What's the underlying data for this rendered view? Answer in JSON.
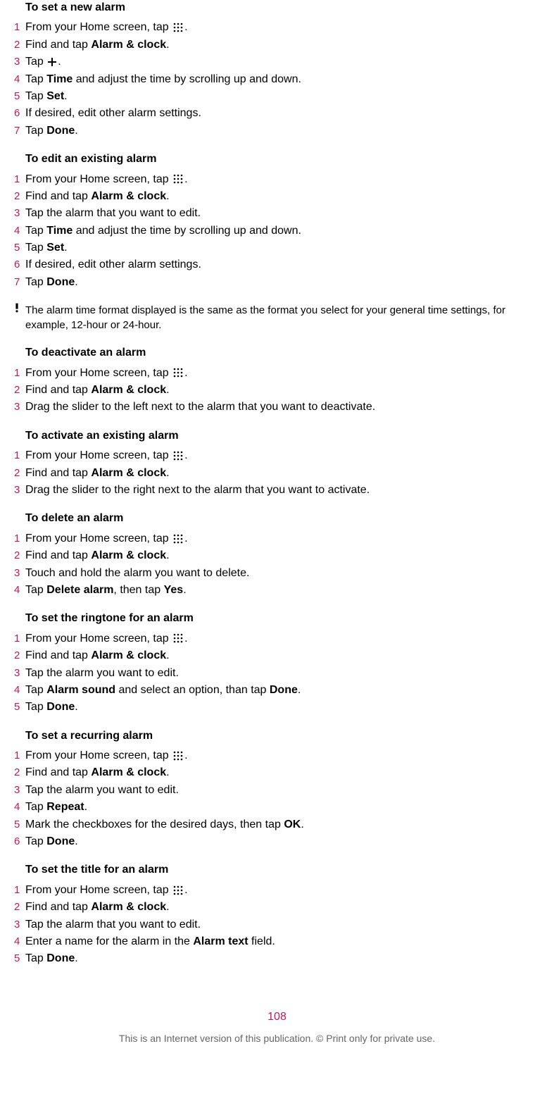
{
  "sections": [
    {
      "title": "To set a new alarm",
      "steps": [
        {
          "num": "1",
          "parts": [
            {
              "t": "From your Home screen, tap "
            },
            {
              "icon": "apps"
            },
            {
              "t": "."
            }
          ]
        },
        {
          "num": "2",
          "parts": [
            {
              "t": "Find and tap "
            },
            {
              "b": "Alarm & clock"
            },
            {
              "t": "."
            }
          ]
        },
        {
          "num": "3",
          "parts": [
            {
              "t": "Tap "
            },
            {
              "icon": "plus"
            },
            {
              "t": "."
            }
          ]
        },
        {
          "num": "4",
          "parts": [
            {
              "t": "Tap "
            },
            {
              "b": "Time"
            },
            {
              "t": " and adjust the time by scrolling up and down."
            }
          ]
        },
        {
          "num": "5",
          "parts": [
            {
              "t": "Tap "
            },
            {
              "b": "Set"
            },
            {
              "t": "."
            }
          ]
        },
        {
          "num": "6",
          "parts": [
            {
              "t": "If desired, edit other alarm settings."
            }
          ]
        },
        {
          "num": "7",
          "parts": [
            {
              "t": "Tap "
            },
            {
              "b": "Done"
            },
            {
              "t": "."
            }
          ]
        }
      ]
    },
    {
      "title": "To edit an existing alarm",
      "steps": [
        {
          "num": "1",
          "parts": [
            {
              "t": "From your Home screen, tap "
            },
            {
              "icon": "apps"
            },
            {
              "t": "."
            }
          ]
        },
        {
          "num": "2",
          "parts": [
            {
              "t": "Find and tap "
            },
            {
              "b": "Alarm & clock"
            },
            {
              "t": "."
            }
          ]
        },
        {
          "num": "3",
          "parts": [
            {
              "t": "Tap the alarm that you want to edit."
            }
          ]
        },
        {
          "num": "4",
          "parts": [
            {
              "t": "Tap "
            },
            {
              "b": "Time"
            },
            {
              "t": " and adjust the time by scrolling up and down."
            }
          ]
        },
        {
          "num": "5",
          "parts": [
            {
              "t": "Tap "
            },
            {
              "b": "Set"
            },
            {
              "t": "."
            }
          ]
        },
        {
          "num": "6",
          "parts": [
            {
              "t": "If desired, edit other alarm settings."
            }
          ]
        },
        {
          "num": "7",
          "parts": [
            {
              "t": "Tap "
            },
            {
              "b": "Done"
            },
            {
              "t": "."
            }
          ]
        }
      ]
    }
  ],
  "note1": "The alarm time format displayed is the same as the format you select for your general time settings, for example, 12-hour or 24-hour.",
  "sections2": [
    {
      "title": "To deactivate an alarm",
      "steps": [
        {
          "num": "1",
          "parts": [
            {
              "t": "From your Home screen, tap "
            },
            {
              "icon": "apps"
            },
            {
              "t": "."
            }
          ]
        },
        {
          "num": "2",
          "parts": [
            {
              "t": "Find and tap "
            },
            {
              "b": "Alarm & clock"
            },
            {
              "t": "."
            }
          ]
        },
        {
          "num": "3",
          "parts": [
            {
              "t": "Drag the slider to the left next to the alarm that you want to deactivate."
            }
          ]
        }
      ]
    },
    {
      "title": "To activate an existing alarm",
      "steps": [
        {
          "num": "1",
          "parts": [
            {
              "t": "From your Home screen, tap "
            },
            {
              "icon": "apps"
            },
            {
              "t": "."
            }
          ]
        },
        {
          "num": "2",
          "parts": [
            {
              "t": "Find and tap "
            },
            {
              "b": "Alarm & clock"
            },
            {
              "t": "."
            }
          ]
        },
        {
          "num": "3",
          "parts": [
            {
              "t": "Drag the slider to the right next to the alarm that you want to activate."
            }
          ]
        }
      ]
    },
    {
      "title": "To delete an alarm",
      "steps": [
        {
          "num": "1",
          "parts": [
            {
              "t": "From your Home screen, tap "
            },
            {
              "icon": "apps"
            },
            {
              "t": "."
            }
          ]
        },
        {
          "num": "2",
          "parts": [
            {
              "t": "Find and tap "
            },
            {
              "b": "Alarm & clock"
            },
            {
              "t": "."
            }
          ]
        },
        {
          "num": "3",
          "parts": [
            {
              "t": "Touch and hold the alarm you want to delete."
            }
          ]
        },
        {
          "num": "4",
          "parts": [
            {
              "t": "Tap "
            },
            {
              "b": "Delete alarm"
            },
            {
              "t": ", then tap "
            },
            {
              "b": "Yes"
            },
            {
              "t": "."
            }
          ]
        }
      ]
    },
    {
      "title": "To set the ringtone for an alarm",
      "steps": [
        {
          "num": "1",
          "parts": [
            {
              "t": "From your Home screen, tap "
            },
            {
              "icon": "apps"
            },
            {
              "t": "."
            }
          ]
        },
        {
          "num": "2",
          "parts": [
            {
              "t": "Find and tap "
            },
            {
              "b": "Alarm & clock"
            },
            {
              "t": "."
            }
          ]
        },
        {
          "num": "3",
          "parts": [
            {
              "t": "Tap the alarm you want to edit."
            }
          ]
        },
        {
          "num": "4",
          "parts": [
            {
              "t": "Tap "
            },
            {
              "b": "Alarm sound"
            },
            {
              "t": " and select an option, than tap "
            },
            {
              "b": "Done"
            },
            {
              "t": "."
            }
          ]
        },
        {
          "num": "5",
          "parts": [
            {
              "t": "Tap "
            },
            {
              "b": "Done"
            },
            {
              "t": "."
            }
          ]
        }
      ]
    },
    {
      "title": "To set a recurring alarm",
      "steps": [
        {
          "num": "1",
          "parts": [
            {
              "t": "From your Home screen, tap "
            },
            {
              "icon": "apps"
            },
            {
              "t": "."
            }
          ]
        },
        {
          "num": "2",
          "parts": [
            {
              "t": "Find and tap "
            },
            {
              "b": "Alarm & clock"
            },
            {
              "t": "."
            }
          ]
        },
        {
          "num": "3",
          "parts": [
            {
              "t": "Tap the alarm you want to edit."
            }
          ]
        },
        {
          "num": "4",
          "parts": [
            {
              "t": "Tap "
            },
            {
              "b": "Repeat"
            },
            {
              "t": "."
            }
          ]
        },
        {
          "num": "5",
          "parts": [
            {
              "t": "Mark the checkboxes for the desired days, then tap "
            },
            {
              "b": "OK"
            },
            {
              "t": "."
            }
          ]
        },
        {
          "num": "6",
          "parts": [
            {
              "t": "Tap "
            },
            {
              "b": "Done"
            },
            {
              "t": "."
            }
          ]
        }
      ]
    },
    {
      "title": "To set the title for an alarm",
      "steps": [
        {
          "num": "1",
          "parts": [
            {
              "t": "From your Home screen, tap "
            },
            {
              "icon": "apps"
            },
            {
              "t": "."
            }
          ]
        },
        {
          "num": "2",
          "parts": [
            {
              "t": "Find and tap "
            },
            {
              "b": "Alarm & clock"
            },
            {
              "t": "."
            }
          ]
        },
        {
          "num": "3",
          "parts": [
            {
              "t": "Tap the alarm that you want to edit."
            }
          ]
        },
        {
          "num": "4",
          "parts": [
            {
              "t": "Enter a name for the alarm in the "
            },
            {
              "b": "Alarm text"
            },
            {
              "t": " field."
            }
          ]
        },
        {
          "num": "5",
          "parts": [
            {
              "t": "Tap "
            },
            {
              "b": "Done"
            },
            {
              "t": "."
            }
          ]
        }
      ]
    }
  ],
  "pageNum": "108",
  "footerText": "This is an Internet version of this publication. © Print only for private use."
}
